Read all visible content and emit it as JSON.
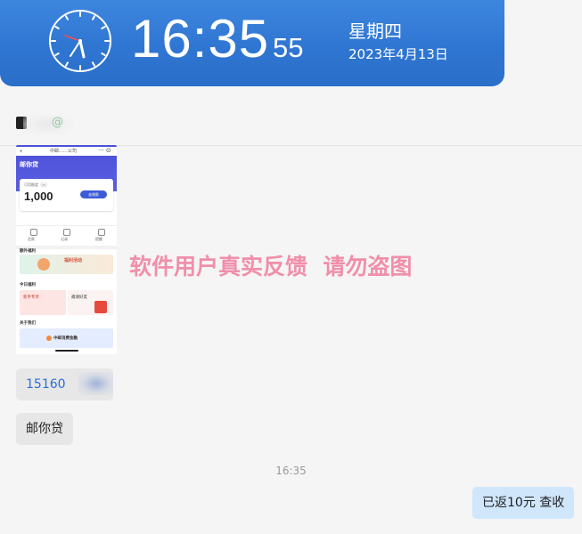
{
  "clock": {
    "time": "16:35",
    "seconds": "55",
    "weekday": "星期四",
    "date": "2023年4月13日"
  },
  "shared_screenshot": {
    "header_title": "中邮……公司",
    "brand": "邮你贷",
    "card_label": "可用额度（元）",
    "card_amount": "1,000",
    "card_button": "去借款",
    "icon_labels": [
      "还款",
      "记录",
      "提额"
    ],
    "section_1": "额外福利",
    "section_2": "今日福利",
    "section_3": "关于我们",
    "banner_1": "福利活动",
    "tile_a": "新手专享",
    "tile_b": "邀请好友",
    "banner_2": "中邮消费金融"
  },
  "watermark": "软件用户真实反馈  请勿盗图",
  "messages": {
    "phone": "15160",
    "loan_app": "邮你贷",
    "timestamp": "16:35",
    "reply": "已返10元 查收"
  },
  "colors": {
    "banner": "#2f76d2",
    "watermark": "#f08aa5",
    "incoming_bubble": "#e7e7e7",
    "outgoing_bubble": "#cfe6fb",
    "link": "#2b6ed8"
  }
}
